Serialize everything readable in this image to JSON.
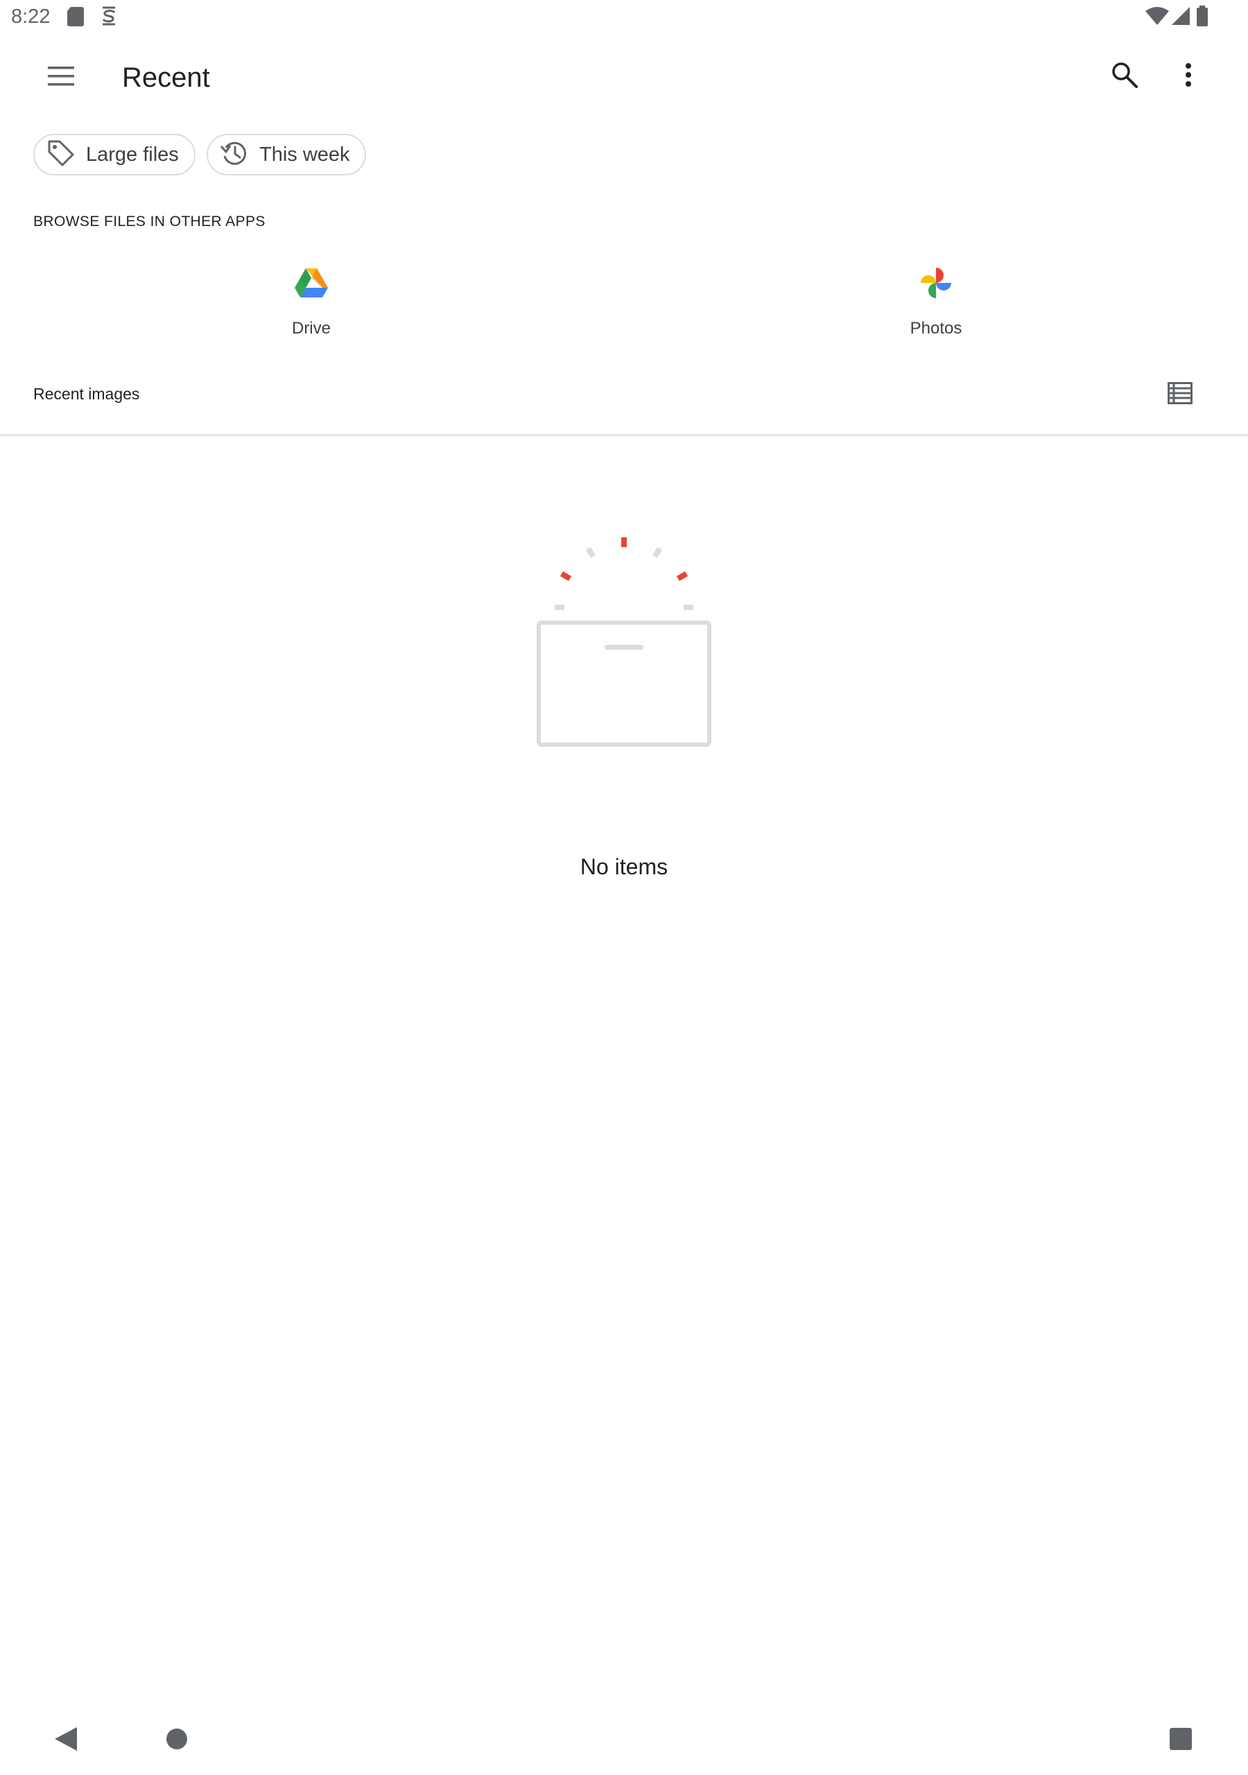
{
  "status_bar": {
    "time": "8:22",
    "left_icons": [
      "sd-card-icon",
      "storage-saver-icon"
    ],
    "right_icons": [
      "wifi-icon",
      "cell-signal-icon",
      "battery-icon"
    ]
  },
  "app_bar": {
    "title": "Recent",
    "menu_icon": "hamburger-menu-icon",
    "search_icon": "search-icon",
    "more_icon": "more-vertical-icon"
  },
  "chips": [
    {
      "label": "Large files",
      "icon": "tag-icon"
    },
    {
      "label": "This week",
      "icon": "history-icon"
    }
  ],
  "browse_section": {
    "heading": "BROWSE FILES IN OTHER APPS",
    "apps": [
      {
        "label": "Drive",
        "icon": "google-drive-icon"
      },
      {
        "label": "Photos",
        "icon": "google-photos-icon"
      }
    ]
  },
  "recent_images": {
    "label": "Recent images",
    "view_toggle_icon": "list-view-icon"
  },
  "empty_state": {
    "message": "No items",
    "illustration": "empty-box-illustration"
  },
  "nav_bar": {
    "back_icon": "back-icon",
    "home_icon": "home-icon",
    "recents_icon": "recents-icon"
  },
  "colors": {
    "accent_red": "#ea4335",
    "outline_gray": "#dadce0",
    "text_primary": "#202124"
  }
}
